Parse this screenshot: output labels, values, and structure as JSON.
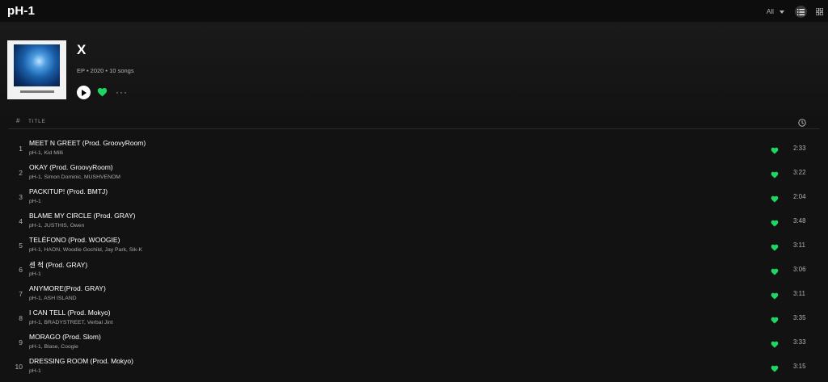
{
  "header": {
    "artist_title": "pH-1",
    "filter_label": "All",
    "filter_icon": "chevron-down-icon",
    "list_view_icon": "list-view-icon",
    "grid_view_icon": "grid-view-icon"
  },
  "album": {
    "title": "X",
    "meta": "EP • 2020 • 10 songs",
    "play_icon": "play-icon",
    "heart_icon": "heart-icon",
    "more_label": "···"
  },
  "columns": {
    "number": "#",
    "title": "TITLE",
    "duration_icon": "clock-icon"
  },
  "colors": {
    "accent_green": "#1ed760",
    "background": "#121212"
  },
  "tracks": [
    {
      "number": "1",
      "title": "MEET N GREET (Prod. GroovyRoom)",
      "artists": "pH-1, Kid Milli",
      "duration": "2:33"
    },
    {
      "number": "2",
      "title": "OKAY (Prod. GroovyRoom)",
      "artists": "pH-1, Simon Dominic, MUSHVENOM",
      "duration": "3:22"
    },
    {
      "number": "3",
      "title": "PACKITUP! (Prod. BMTJ)",
      "artists": "pH-1",
      "duration": "2:04"
    },
    {
      "number": "4",
      "title": "BLAME MY CIRCLE (Prod. GRAY)",
      "artists": "pH-1, JUSTHIS, Owen",
      "duration": "3:48"
    },
    {
      "number": "5",
      "title": "TELÉFONO (Prod. WOOGIE)",
      "artists": "pH-1, HAON, Woodie Gochild, Jay Park, Sik-K",
      "duration": "3:11"
    },
    {
      "number": "6",
      "title": "센 척 (Prod. GRAY)",
      "artists": "pH-1",
      "duration": "3:06"
    },
    {
      "number": "7",
      "title": "ANYMORE(Prod. GRAY)",
      "artists": "pH-1, ASH ISLAND",
      "duration": "3:11"
    },
    {
      "number": "8",
      "title": "I CAN TELL (Prod. Mokyo)",
      "artists": "pH-1, BRADYSTREET, Verbal Jint",
      "duration": "3:35"
    },
    {
      "number": "9",
      "title": "MORAGO (Prod. Slom)",
      "artists": "pH-1, Blase, Coogie",
      "duration": "3:33"
    },
    {
      "number": "10",
      "title": "DRESSING ROOM (Prod. Mokyo)",
      "artists": "pH-1",
      "duration": "3:15"
    }
  ]
}
